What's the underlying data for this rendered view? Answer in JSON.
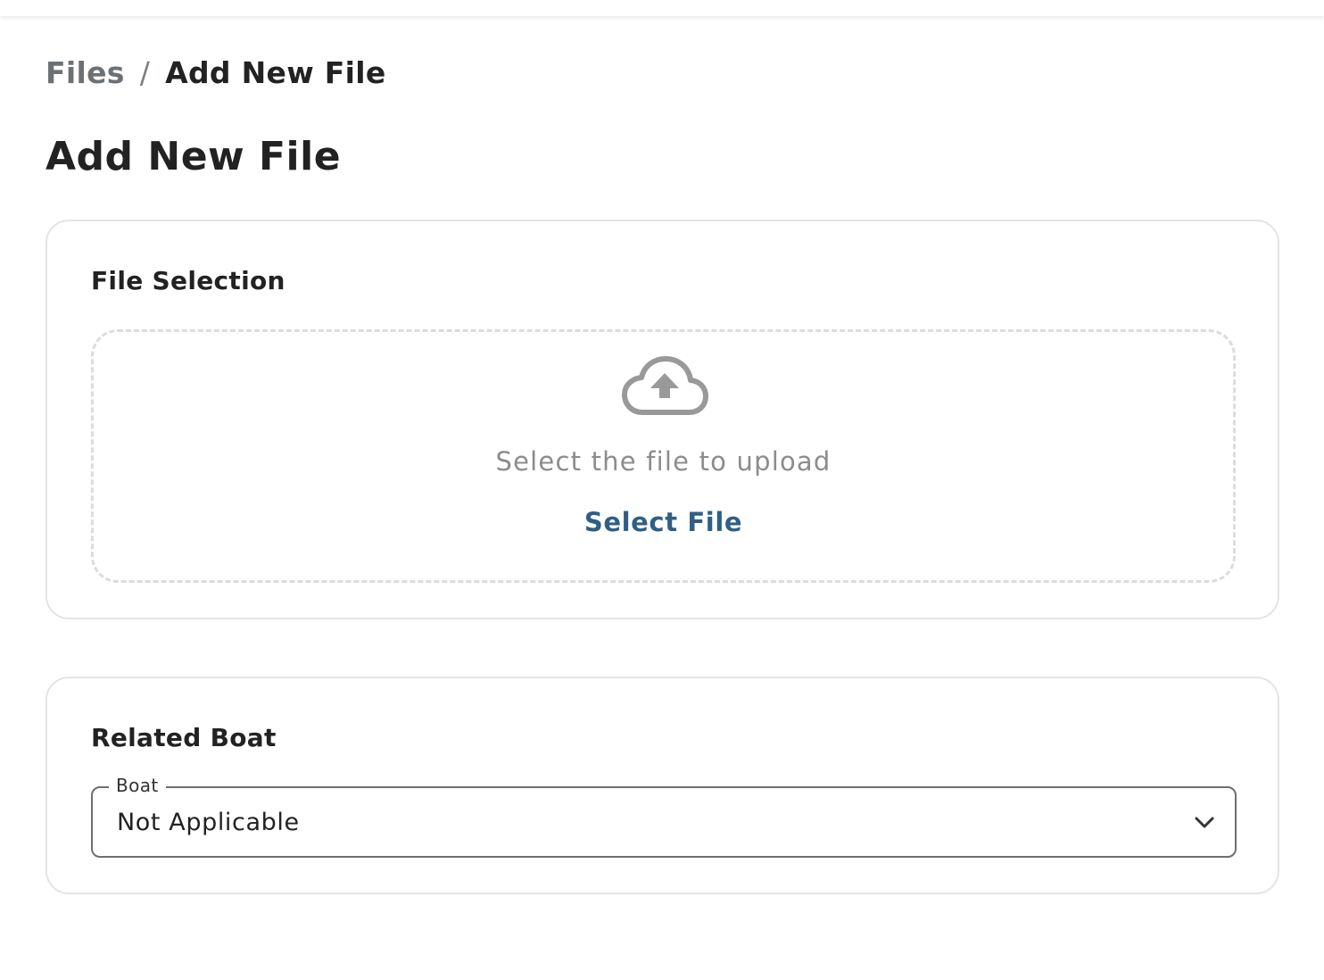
{
  "breadcrumb": {
    "parent": "Files",
    "separator": "/",
    "current": "Add New File"
  },
  "page": {
    "title": "Add New File"
  },
  "file_selection": {
    "title": "File Selection",
    "icon": "cloud-upload-icon",
    "prompt": "Select the file to upload",
    "button_label": "Select File"
  },
  "related_boat": {
    "title": "Related Boat",
    "field_label": "Boat",
    "selected_value": "Not Applicable",
    "icon": "chevron-down-icon"
  },
  "colors": {
    "link": "#2f5f85",
    "muted_text": "#8c8c8c",
    "breadcrumb_parent": "#6b7175",
    "border": "#e4e4e4",
    "dashed_border": "#dcdcdc",
    "icon": "#999999"
  }
}
